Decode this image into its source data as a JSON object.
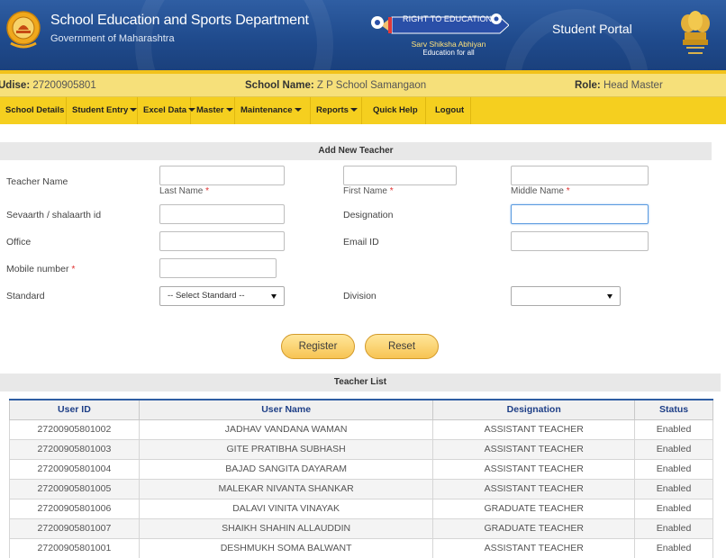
{
  "header": {
    "title": "School Education and Sports Department",
    "subtitle": "Government of Maharashtra",
    "rte_label": "RIGHT TO EDUCATION",
    "rte_sub1": "Sarv Shiksha Abhiyan",
    "rte_sub2": "Education for all",
    "portal": "Student Portal"
  },
  "info": {
    "udise_label": "Udise:",
    "udise_value": "27200905801",
    "school_label": "School Name:",
    "school_value": "Z P School Samangaon",
    "role_label": "Role:",
    "role_value": "Head Master"
  },
  "nav": [
    {
      "label": "School Details",
      "dropdown": false
    },
    {
      "label": "Student Entry",
      "dropdown": true
    },
    {
      "label": "Excel Data",
      "dropdown": true
    },
    {
      "label": "Master",
      "dropdown": true
    },
    {
      "label": "Maintenance",
      "dropdown": true
    },
    {
      "label": "Reports",
      "dropdown": true
    },
    {
      "label": "Quick Help",
      "dropdown": false
    },
    {
      "label": "Logout",
      "dropdown": false
    }
  ],
  "form": {
    "section_title": "Add New Teacher",
    "teacher_name_label": "Teacher Name",
    "last_name_label": "Last Name",
    "first_name_label": "First Name",
    "middle_name_label": "Middle Name",
    "required_mark": "*",
    "sevaarth_label": "Sevaarth / shalaarth id",
    "designation_label": "Designation",
    "office_label": "Office",
    "email_label": "Email ID",
    "mobile_label": "Mobile number",
    "standard_label": "Standard",
    "standard_value": "-- Select Standard --",
    "division_label": "Division",
    "division_value": "",
    "register_label": "Register",
    "reset_label": "Reset"
  },
  "teacher_list": {
    "section_title": "Teacher List",
    "columns": [
      "User ID",
      "User Name",
      "Designation",
      "Status"
    ],
    "rows": [
      [
        "27200905801002",
        "JADHAV VANDANA WAMAN",
        "ASSISTANT TEACHER",
        "Enabled"
      ],
      [
        "27200905801003",
        "GITE PRATIBHA SUBHASH",
        "ASSISTANT TEACHER",
        "Enabled"
      ],
      [
        "27200905801004",
        "BAJAD SANGITA DAYARAM",
        "ASSISTANT TEACHER",
        "Enabled"
      ],
      [
        "27200905801005",
        "MALEKAR NIVANTA SHANKAR",
        "ASSISTANT TEACHER",
        "Enabled"
      ],
      [
        "27200905801006",
        "DALAVI VINITA VINAYAK",
        "GRADUATE TEACHER",
        "Enabled"
      ],
      [
        "27200905801007",
        "SHAIKH SHAHIN ALLAUDDIN",
        "GRADUATE TEACHER",
        "Enabled"
      ],
      [
        "27200905801001",
        "DESHMUKH SOMA BALWANT",
        "ASSISTANT TEACHER",
        "Enabled"
      ]
    ]
  },
  "colors": {
    "header_blue": "#2f5ea3",
    "nav_yellow": "#f5cf1f",
    "info_yellow": "#f6e07a",
    "table_header_text": "#1e3f87"
  },
  "icons": [
    "maharashtra-seal-icon",
    "rte-pencil-icon",
    "national-emblem-icon",
    "dropdown-caret-icon"
  ]
}
